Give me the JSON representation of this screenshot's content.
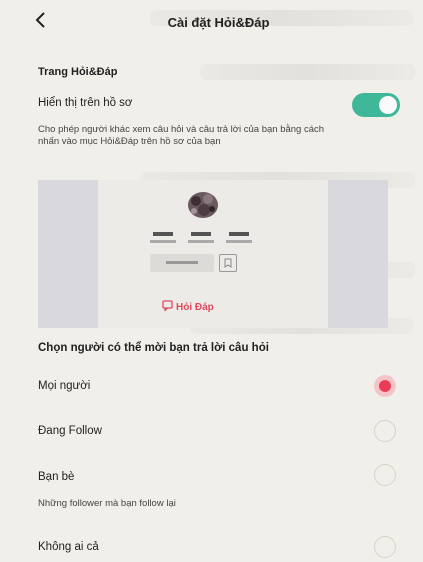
{
  "header": {
    "title": "Cài đặt Hỏi&Đáp",
    "back_icon": "chevron-left-icon"
  },
  "qa_page": {
    "section_title": "Trang Hỏi&Đáp",
    "show_on_profile_label": "Hiển thị trên hồ sơ",
    "show_on_profile_enabled": true,
    "show_on_profile_desc_line1": "Cho phép người khác xem câu hỏi và câu trả lời của bạn bằng cách",
    "show_on_profile_desc_line2": "nhấn vào mục Hỏi&Đáp trên hồ sơ của bạn",
    "preview_link": "Hỏi Đáp"
  },
  "invite": {
    "section_title": "Chọn người có thể mời bạn trả lời câu hỏi",
    "options": [
      {
        "label": "Mọi người",
        "selected": true
      },
      {
        "label": "Đang Follow",
        "selected": false
      },
      {
        "label": "Bạn bè",
        "selected": false,
        "desc": "Những follower mà bạn follow lại"
      },
      {
        "label": "Không ai cả",
        "selected": false
      }
    ]
  },
  "colors": {
    "toggle_on": "#3fb89a",
    "radio_selected": "#ea3d55",
    "accent_link": "#e04a5c"
  }
}
